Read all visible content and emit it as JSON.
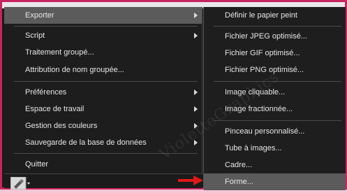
{
  "left_menu": {
    "items": [
      {
        "label": "Exporter",
        "submenu": true,
        "highlighted": true
      },
      {
        "label": "Script",
        "submenu": true
      },
      {
        "label": "Traitement groupé...",
        "submenu": false
      },
      {
        "label": "Attribution de nom groupée...",
        "submenu": false
      },
      {
        "label": "Préférences",
        "submenu": true
      },
      {
        "label": "Espace de travail",
        "submenu": true
      },
      {
        "label": "Gestion des couleurs",
        "submenu": true
      },
      {
        "label": "Sauvegarde de la base de données",
        "submenu": true
      },
      {
        "label": "Quitter",
        "submenu": false
      }
    ]
  },
  "right_menu": {
    "items": [
      {
        "label": "Définir le papier peint"
      },
      {
        "label": "Fichier JPEG optimisé..."
      },
      {
        "label": "Fichier GIF optimisé..."
      },
      {
        "label": "Fichier PNG optimisé..."
      },
      {
        "label": "Image cliquable..."
      },
      {
        "label": "Image fractionnée..."
      },
      {
        "label": "Pinceau personnalisé..."
      },
      {
        "label": "Tube à images..."
      },
      {
        "label": "Cadre..."
      },
      {
        "label": "Forme...",
        "highlighted": true
      }
    ]
  },
  "watermark": "VioletteGraphics",
  "colors": {
    "border": "#c8245f",
    "highlight": "#5b5b5b",
    "arrow": "#e01818"
  }
}
